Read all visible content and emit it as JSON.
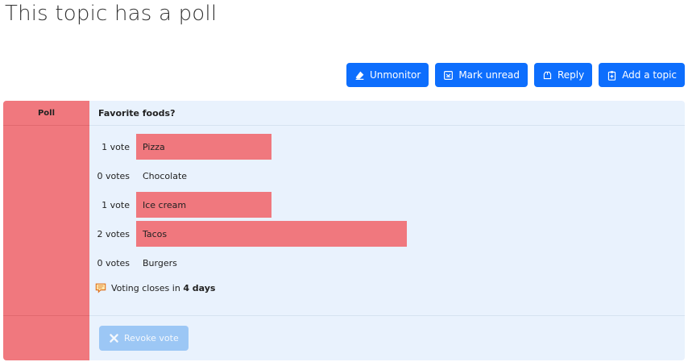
{
  "page": {
    "title": "This topic has a poll"
  },
  "toolbar": {
    "unmonitor": "Unmonitor",
    "mark_unread": "Mark unread",
    "reply": "Reply",
    "add_topic": "Add a topic"
  },
  "poll": {
    "side_label": "Poll",
    "question": "Favorite foods?",
    "max_votes": 2,
    "options": [
      {
        "count_label": "1 vote",
        "votes": 1,
        "label": "Pizza"
      },
      {
        "count_label": "0 votes",
        "votes": 0,
        "label": "Chocolate"
      },
      {
        "count_label": "1 vote",
        "votes": 1,
        "label": "Ice cream"
      },
      {
        "count_label": "2 votes",
        "votes": 2,
        "label": "Tacos"
      },
      {
        "count_label": "0 votes",
        "votes": 0,
        "label": "Burgers"
      }
    ],
    "closes_prefix": "Voting closes in",
    "closes_value": "4 days",
    "revoke_label": "Revoke vote"
  },
  "colors": {
    "primary": "#0d6efd",
    "poll_accent": "#f0787e",
    "poll_bg": "#e9f2fd",
    "revoke_disabled": "#9cc7f5"
  },
  "icons": {
    "unmonitor": "eraser-icon",
    "mark_unread": "mark-unread-icon",
    "reply": "reply-icon",
    "add_topic": "clipboard-plus-icon",
    "closes": "chat-bubble-icon",
    "revoke": "x-icon"
  }
}
